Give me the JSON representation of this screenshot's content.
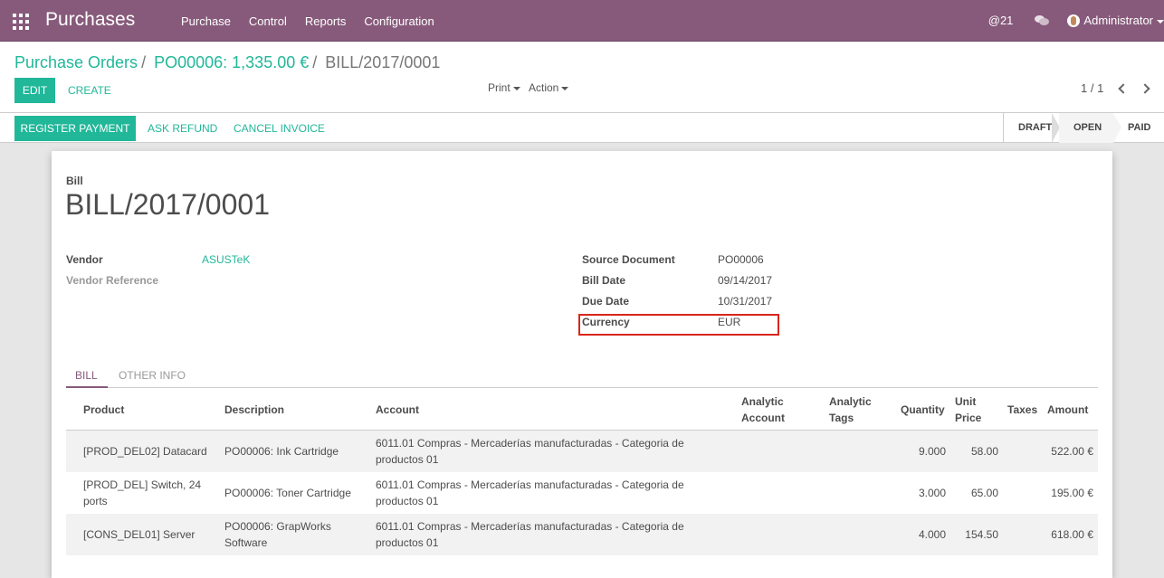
{
  "navbar": {
    "brand": "Purchases",
    "menu": [
      "Purchase",
      "Control",
      "Reports",
      "Configuration"
    ],
    "mentions": "@21",
    "user": "Administrator"
  },
  "breadcrumb": {
    "root": "Purchase Orders",
    "parent": "PO00006: 1,335.00 €",
    "current": "BILL/2017/0001"
  },
  "buttons": {
    "edit": "EDIT",
    "create": "CREATE",
    "print": "Print",
    "action": "Action"
  },
  "pager": "1 / 1",
  "statusbar": {
    "register_payment": "REGISTER PAYMENT",
    "ask_refund": "ASK REFUND",
    "cancel_invoice": "CANCEL INVOICE",
    "stages": [
      "DRAFT",
      "OPEN",
      "PAID"
    ],
    "current_stage": "OPEN"
  },
  "bill": {
    "type": "Bill",
    "name": "BILL/2017/0001",
    "vendor_label": "Vendor",
    "vendor": "ASUSTeK",
    "vendor_ref_label": "Vendor Reference",
    "source_label": "Source Document",
    "source": "PO00006",
    "bill_date_label": "Bill Date",
    "bill_date": "09/14/2017",
    "due_date_label": "Due Date",
    "due_date": "10/31/2017",
    "currency_label": "Currency",
    "currency": "EUR"
  },
  "tabs": {
    "bill": "BILL",
    "other": "OTHER INFO"
  },
  "table": {
    "headers": {
      "product": "Product",
      "description": "Description",
      "account": "Account",
      "analytic_account_1": "Analytic",
      "analytic_account_2": "Account",
      "analytic_tags_1": "Analytic",
      "analytic_tags_2": "Tags",
      "quantity": "Quantity",
      "unit_price_1": "Unit",
      "unit_price_2": "Price",
      "taxes": "Taxes",
      "amount": "Amount"
    },
    "rows": [
      {
        "product": [
          "[PROD_DEL02] Datacard"
        ],
        "description": [
          "PO00006: Ink Cartridge"
        ],
        "account": [
          "6011.01 Compras - Mercaderías manufacturadas - Categoria de",
          "productos 01"
        ],
        "quantity": "9.000",
        "unit_price": "58.00",
        "amount": "522.00 €"
      },
      {
        "product": [
          "[PROD_DEL] Switch, 24",
          "ports"
        ],
        "description": [
          "PO00006: Toner Cartridge"
        ],
        "account": [
          "6011.01 Compras - Mercaderías manufacturadas - Categoria de",
          "productos 01"
        ],
        "quantity": "3.000",
        "unit_price": "65.00",
        "amount": "195.00 €"
      },
      {
        "product": [
          "[CONS_DEL01] Server"
        ],
        "description": [
          "PO00006: GrapWorks",
          "Software"
        ],
        "account": [
          "6011.01 Compras - Mercaderías manufacturadas - Categoria de",
          "productos 01"
        ],
        "quantity": "4.000",
        "unit_price": "154.50",
        "amount": "618.00 €"
      }
    ]
  },
  "colors": {
    "brand": "#875a7b",
    "accent": "#21b799",
    "highlight": "#d9261c"
  }
}
